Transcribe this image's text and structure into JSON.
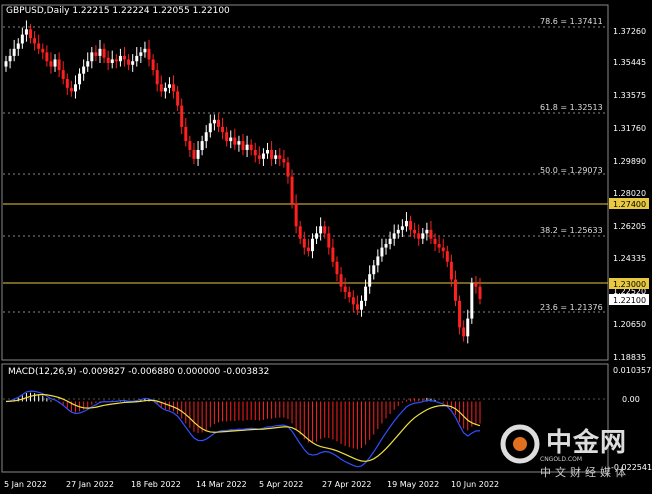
{
  "header": {
    "symbol_tf": "GBPUSD,Daily",
    "ohlc": "1.22215 1.22224 1.22055 1.22100"
  },
  "macd": {
    "label": "MACD(12,26,9) -0.009827 -0.006880 0.000000 -0.003832",
    "scale": [
      "0.010357",
      "0.00",
      "-0.022541"
    ]
  },
  "price_axis": [
    "1.37260",
    "1.35445",
    "1.33575",
    "1.31760",
    "1.29890",
    "1.28020",
    "1.26205",
    "1.24335",
    "1.22520",
    "1.20650",
    "1.18835"
  ],
  "fib_levels": [
    "78.6 = 1.37411",
    "61.8 = 1.32513",
    "50.0 = 1.29073",
    "38.2 = 1.25633",
    "23.6 = 1.21376"
  ],
  "price_tags": {
    "line1": "1.27400",
    "line2": "1.23000",
    "current": "1.22100"
  },
  "dates": [
    "5 Jan 2022",
    "27 Jan 2022",
    "18 Feb 2022",
    "14 Mar 2022",
    "5 Apr 2022",
    "27 Apr 2022",
    "19 May 2022",
    "10 Jun 2022"
  ],
  "watermark": {
    "cn": "中金网",
    "sub": "CNGOLD.COM",
    "cn2": "中文财经媒体"
  },
  "colors": {
    "up": "#ffffff",
    "down": "#ff2020",
    "hline": "#e8c840",
    "macd_fast": "#3050ff",
    "macd_slow": "#f0e040"
  },
  "chart_data": {
    "type": "candlestick",
    "closes": [
      1.355,
      1.358,
      1.362,
      1.365,
      1.37,
      1.373,
      1.368,
      1.365,
      1.362,
      1.36,
      1.355,
      1.352,
      1.356,
      1.35,
      1.345,
      1.34,
      1.338,
      1.342,
      1.348,
      1.352,
      1.355,
      1.36,
      1.358,
      1.362,
      1.357,
      1.354,
      1.356,
      1.355,
      1.358,
      1.356,
      1.353,
      1.355,
      1.358,
      1.36,
      1.362,
      1.356,
      1.35,
      1.342,
      1.338,
      1.34,
      1.342,
      1.338,
      1.33,
      1.318,
      1.31,
      1.305,
      1.3,
      1.305,
      1.31,
      1.315,
      1.32,
      1.322,
      1.318,
      1.315,
      1.31,
      1.312,
      1.308,
      1.31,
      1.305,
      1.308,
      1.305,
      1.302,
      1.3,
      1.303,
      1.305,
      1.3,
      1.302,
      1.3,
      1.298,
      1.29,
      1.275,
      1.262,
      1.255,
      1.25,
      1.248,
      1.255,
      1.258,
      1.262,
      1.258,
      1.25,
      1.242,
      1.235,
      1.228,
      1.225,
      1.222,
      1.218,
      1.215,
      1.22,
      1.228,
      1.235,
      1.24,
      1.245,
      1.25,
      1.252,
      1.255,
      1.258,
      1.26,
      1.262,
      1.265,
      1.26,
      1.258,
      1.255,
      1.258,
      1.26,
      1.255,
      1.252,
      1.25,
      1.248,
      1.242,
      1.232,
      1.22,
      1.205,
      1.2,
      1.21,
      1.23,
      1.228,
      1.221
    ]
  }
}
